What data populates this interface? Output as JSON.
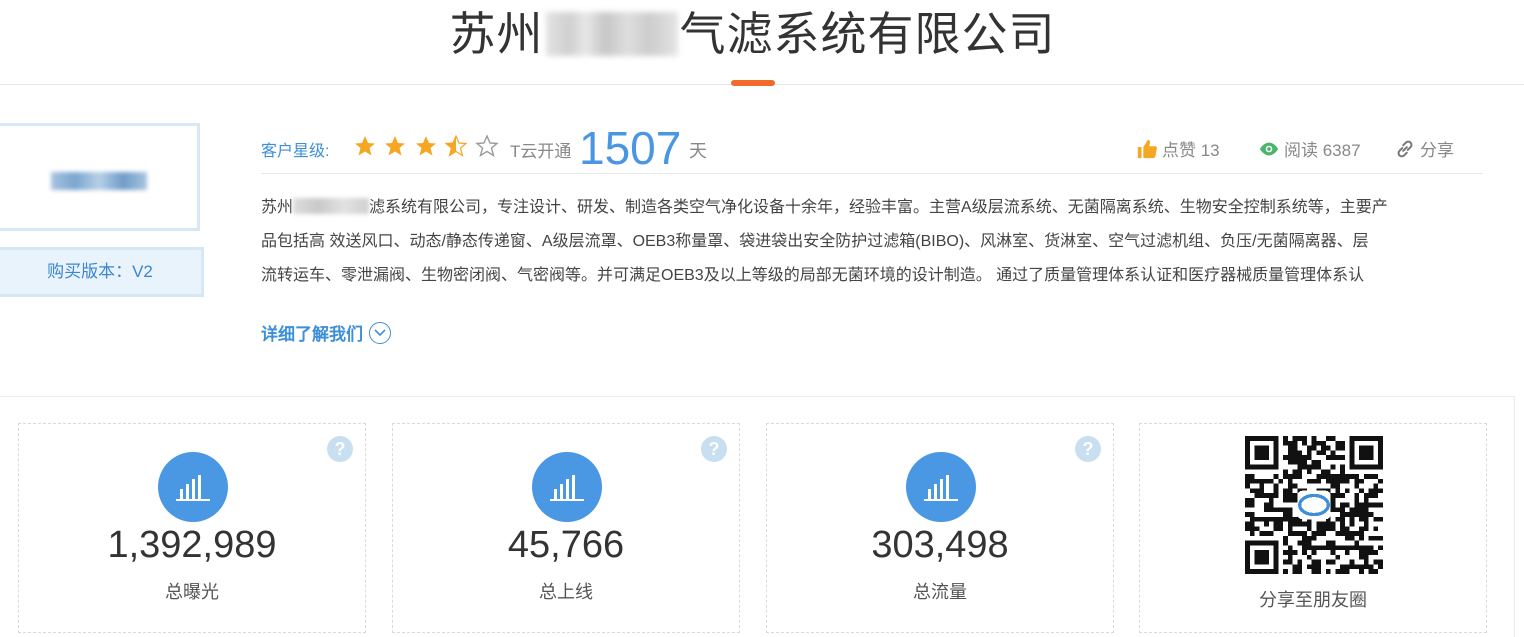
{
  "company": {
    "title_prefix": "苏州",
    "title_suffix": "气滤系统有限公司",
    "version": "购买版本：V2"
  },
  "info": {
    "star_label": "客户星级:",
    "rating": 3.5,
    "rating_max": 5,
    "tyun_label": "T云开通",
    "days": "1507",
    "days_unit": "天",
    "like_label": "点赞 13",
    "read_label": "阅读 6387",
    "share_label": "分享"
  },
  "description": {
    "line1_prefix": "苏州",
    "line1_rest": "滤系统有限公司，专注设计、研发、制造各类空气净化设备十余年，经验丰富。主营A级层流系统、无菌隔离系统、生物安全控制系统等，主要产",
    "line2": "品包括高 效送风口、动态/静态传递窗、A级层流罩、OEB3称量罩、袋进袋出安全防护过滤箱(BIBO)、风淋室、货淋室、空气过滤机组、负压/无菌隔离器、层",
    "line3": "流转运车、零泄漏阀、生物密闭阀、气密阀等。并可满足OEB3及以上等级的局部无菌环境的设计制造。 通过了质量管理体系认证和医疗器械质量管理体系认",
    "more_label": "详细了解我们"
  },
  "stats": [
    {
      "value": "1,392,989",
      "label": "总曝光"
    },
    {
      "value": "45,766",
      "label": "总上线"
    },
    {
      "value": "303,498",
      "label": "总流量"
    }
  ],
  "qr": {
    "label": "分享至朋友圈"
  },
  "colors": {
    "accent": "#4a96e3",
    "orange": "#f06a2b",
    "star": "#f5a623",
    "eye": "#4bb56b"
  }
}
